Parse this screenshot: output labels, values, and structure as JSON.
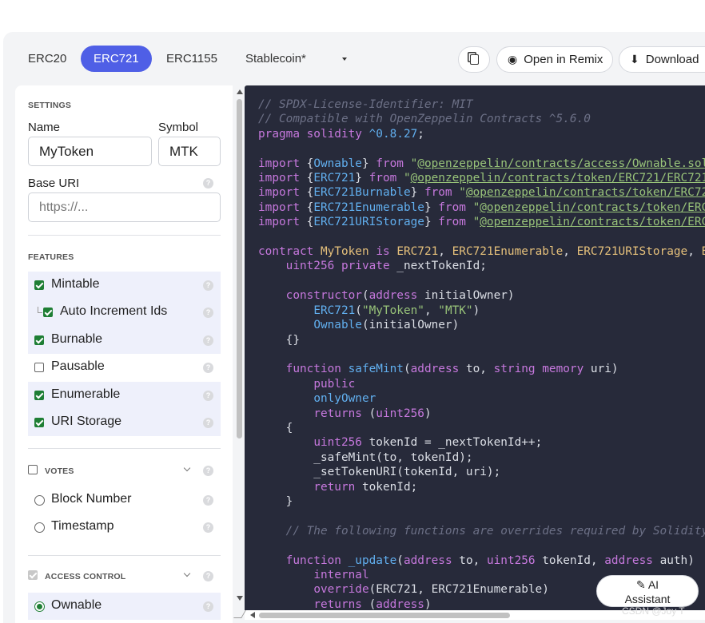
{
  "tabs": [
    "ERC20",
    "ERC721",
    "ERC1155",
    "Stablecoin*"
  ],
  "active_tab": "ERC721",
  "toolbar": {
    "open_remix": "Open in Remix",
    "download": "Download"
  },
  "settings": {
    "heading": "SETTINGS",
    "name_label": "Name",
    "name_value": "MyToken",
    "symbol_label": "Symbol",
    "symbol_value": "MTK",
    "base_uri_label": "Base URI",
    "base_uri_placeholder": "https://..."
  },
  "features": {
    "heading": "FEATURES",
    "items": [
      {
        "label": "Mintable",
        "checked": true
      },
      {
        "label": "Auto Increment Ids",
        "checked": true
      },
      {
        "label": "Burnable",
        "checked": true
      },
      {
        "label": "Pausable",
        "checked": false
      },
      {
        "label": "Enumerable",
        "checked": true
      },
      {
        "label": "URI Storage",
        "checked": true
      }
    ]
  },
  "votes": {
    "heading": "VOTES",
    "options": [
      "Block Number",
      "Timestamp"
    ]
  },
  "access_control": {
    "heading": "ACCESS CONTROL",
    "selected": "Ownable"
  },
  "help_glyph": "?",
  "ai_assistant": {
    "line1": "AI",
    "line2": "Assistant"
  },
  "watermark": "CSDN @Joy T",
  "colors": {
    "accent": "#4f5fe6",
    "code_bg": "#272a3a",
    "check_green": "#1e7e34"
  }
}
